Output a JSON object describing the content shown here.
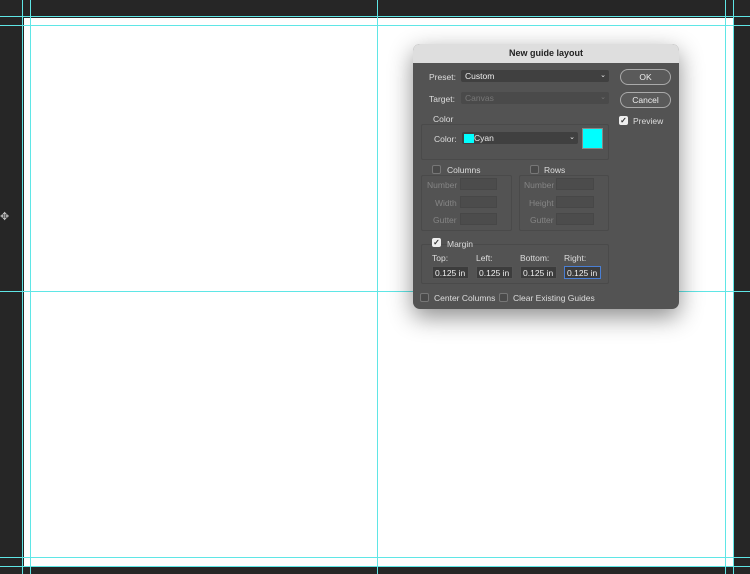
{
  "dialog": {
    "title": "New guide layout",
    "preset_label": "Preset:",
    "preset_value": "Custom",
    "target_label": "Target:",
    "target_value": "Canvas",
    "ok_label": "OK",
    "cancel_label": "Cancel",
    "preview_label": "Preview",
    "preview_checked": true,
    "color_group_label": "Color",
    "color_label": "Color:",
    "color_value": "Cyan",
    "color_hex": "#00ffff",
    "columns": {
      "label": "Columns",
      "checked": false,
      "fields": [
        "Number",
        "Width",
        "Gutter"
      ]
    },
    "rows": {
      "label": "Rows",
      "checked": false,
      "fields": [
        "Number",
        "Height",
        "Gutter"
      ]
    },
    "margin": {
      "label": "Margin",
      "checked": true,
      "top_label": "Top:",
      "left_label": "Left:",
      "bottom_label": "Bottom:",
      "right_label": "Right:",
      "top": "0.125 in",
      "left": "0.125 in",
      "bottom": "0.125 in",
      "right": "0.125 in"
    },
    "center_columns_label": "Center Columns",
    "clear_guides_label": "Clear Existing Guides"
  }
}
